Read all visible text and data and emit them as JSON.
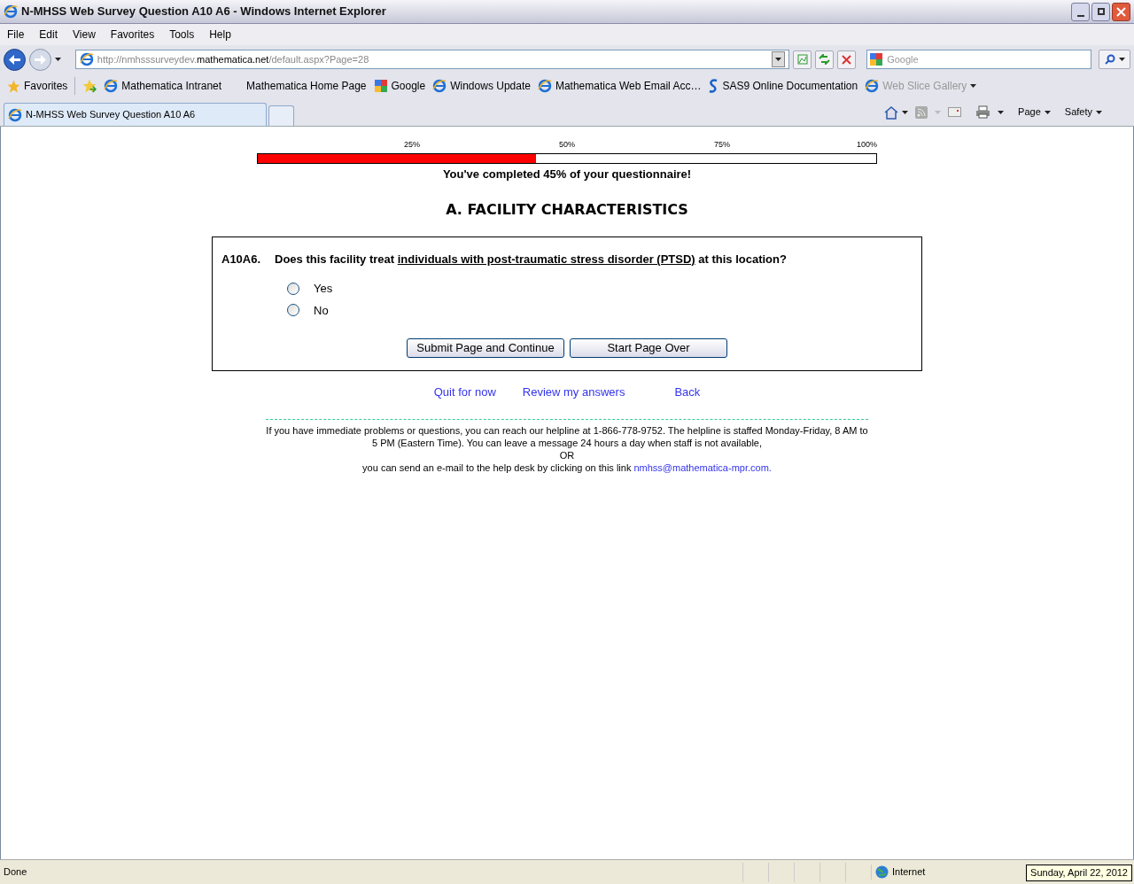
{
  "window": {
    "title": "N-MHSS Web Survey Question A10 A6 - Windows Internet Explorer"
  },
  "menu": [
    "File",
    "Edit",
    "View",
    "Favorites",
    "Tools",
    "Help"
  ],
  "address": {
    "prefix": "http://nmhsssurveydev.",
    "domain": "mathematica.net",
    "path": "/default.aspx?Page=28"
  },
  "search": {
    "placeholder": "Google"
  },
  "favorites": {
    "label": "Favorites",
    "items": [
      {
        "label": "Mathematica Intranet",
        "kind": "ie",
        "disabled": false
      },
      {
        "label": "Mathematica Home Page",
        "kind": "plain",
        "disabled": false
      },
      {
        "label": "Google",
        "kind": "google",
        "disabled": false
      },
      {
        "label": "Windows Update",
        "kind": "ie",
        "disabled": false
      },
      {
        "label": "Mathematica Web Email Acc…",
        "kind": "ie",
        "disabled": false
      },
      {
        "label": "SAS9 Online Documentation",
        "kind": "sas",
        "disabled": false
      },
      {
        "label": "Web Slice Gallery",
        "kind": "ie",
        "disabled": true
      }
    ]
  },
  "tab": {
    "title": "N-MHSS Web Survey Question A10 A6"
  },
  "command_bar": [
    "Page",
    "Safety"
  ],
  "progress": {
    "ticks": [
      "25%",
      "50%",
      "75%",
      "100%"
    ],
    "level": 0.45,
    "caption": "You've completed 45% of your questionnaire!"
  },
  "section_title": "A. FACILITY CHARACTERISTICS",
  "question": {
    "number": "A10A6.",
    "text_before": "Does this facility treat",
    "text_underlined": "individuals with post-traumatic stress disorder (PTSD)",
    "text_after": "at this location?",
    "options": [
      {
        "label": "Yes",
        "selected": false
      },
      {
        "label": "No",
        "selected": false
      }
    ]
  },
  "buttons": [
    "Submit Page and Continue",
    "Start Page Over"
  ],
  "nav_links": [
    "Quit for now",
    "Review my answers",
    "Back"
  ],
  "help": {
    "text": "If you have immediate problems or questions, you can reach our helpline at 1-866-778-9752. The helpline is staffed Monday-Friday, 8 AM to 5 PM (Eastern Time). You can leave a message 24 hours a day when staff is not available,",
    "or": "OR",
    "email_prefix": "you can send an e-mail to the help desk by clicking on this link",
    "email": "nmhss@mathematica-mpr.com."
  },
  "status_bar": {
    "status": "Done",
    "zone": "Internet",
    "tooltip": "Sunday, April 22, 2012"
  }
}
